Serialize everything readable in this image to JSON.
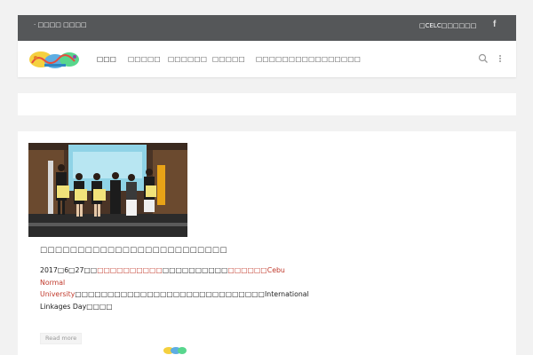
{
  "topbar": {
    "left_text": "· □□□□ □□□□",
    "right_text": "□CELC□□□□□□",
    "social_icon": "facebook-icon",
    "social_glyph": "f"
  },
  "header": {
    "nav": [
      {
        "label": "□□□",
        "active": true
      },
      {
        "label": "□□□□□",
        "active": false
      },
      {
        "label": "□□□□□□",
        "active": false
      },
      {
        "label": "□□□□□",
        "active": false
      },
      {
        "label": "□□□□□□□□□□□□□□□□",
        "active": false
      }
    ],
    "icons": [
      "search-icon",
      "more-vertical-icon"
    ]
  },
  "post": {
    "title": "□□□□□□□□□□□□□□□□□□□□□□□□□",
    "body_parts": [
      {
        "text": " 2017□6□27□□",
        "color": "normal"
      },
      {
        "text": "□□□□□□□□□□",
        "color": "red"
      },
      {
        "text": "□□□□□□□□□□",
        "color": "normal"
      },
      {
        "text": "□□□□□□Cebu Normal University",
        "color": "red"
      },
      {
        "text": "□□□□□□□□□□□□□□□□□□□□□□□□□□□□□International Linkages Day□□□□",
        "color": "normal"
      }
    ],
    "read_more": "Read more"
  },
  "colors": {
    "topbar_bg": "#555759",
    "accent_red": "#c0392b",
    "page_bg": "#f2f2f2"
  }
}
